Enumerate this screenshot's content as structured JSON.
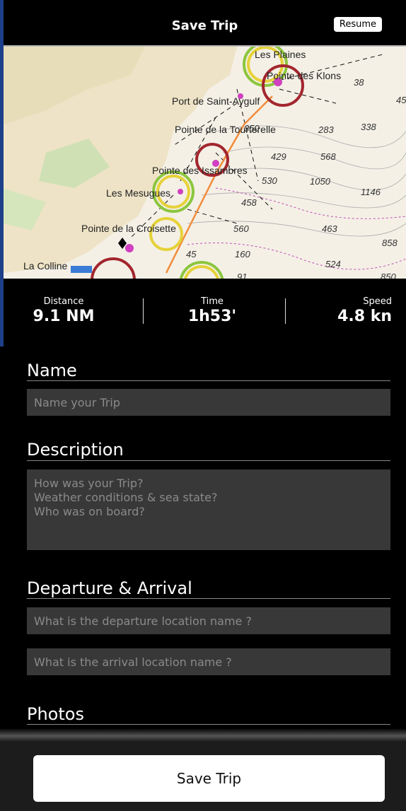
{
  "header": {
    "title": "Save Trip",
    "resume_label": "Resume"
  },
  "map": {
    "places": [
      "Les Plaines",
      "Pointe des Klons",
      "Port de Saint-Aygulf",
      "Pointe de la Tourterelle",
      "Pointe des Issambres",
      "Les Mesugues",
      "Pointe de la Croisette",
      "La Colline"
    ],
    "depths": [
      "38",
      "45",
      "350",
      "283",
      "338",
      "429",
      "568",
      "530",
      "1050",
      "1146",
      "458",
      "560",
      "463",
      "858",
      "160",
      "524",
      "91",
      "850",
      "45"
    ]
  },
  "stats": [
    {
      "label": "Distance",
      "value": "9.1 NM"
    },
    {
      "label": "Time",
      "value": "1h53'"
    },
    {
      "label": "Speed",
      "value": "4.8 kn"
    }
  ],
  "form": {
    "name_title": "Name",
    "name_placeholder": "Name your Trip",
    "description_title": "Description",
    "description_placeholder": "How was your Trip?\nWeather conditions & sea state?\nWho was on board?",
    "departure_title": "Departure & Arrival",
    "departure_placeholder": "What is the departure location name ?",
    "arrival_placeholder": "What is the arrival location name ?",
    "photos_title": "Photos"
  },
  "footer": {
    "save_label": "Save Trip"
  },
  "colors": {
    "accent": "#ffffff",
    "background": "#000000",
    "field": "#383838",
    "route": "#f28c3a"
  }
}
